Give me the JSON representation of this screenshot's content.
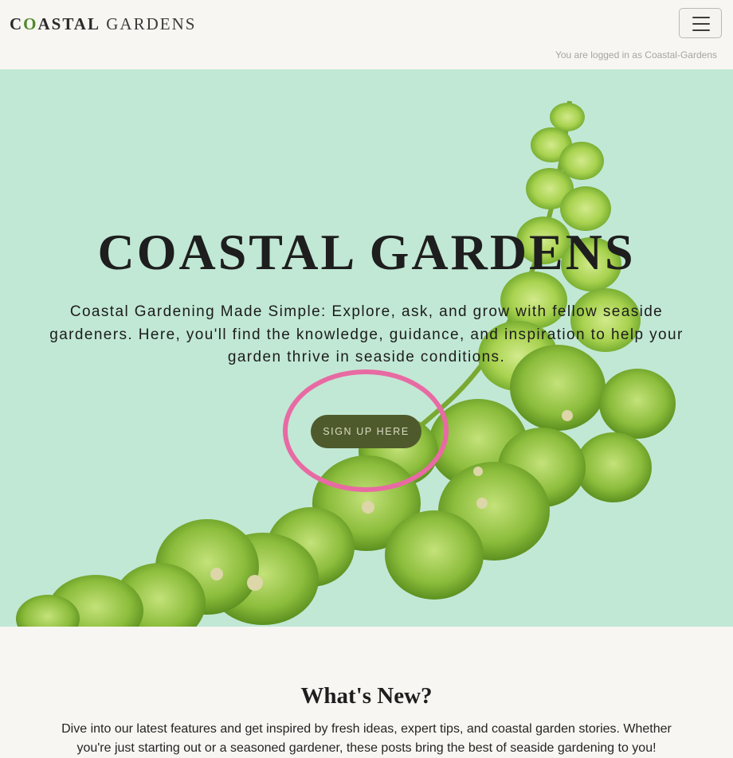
{
  "navbar": {
    "brand_c": "C",
    "brand_o": "O",
    "brand_rest": "ASTAL",
    "brand_second": "GARDENS",
    "menu_icon": "hamburger-menu-icon",
    "login_status": "You are logged in as Coastal-Gardens"
  },
  "hero": {
    "title": "COASTAL GARDENS",
    "subtitle": "Coastal Gardening Made Simple: Explore, ask, and grow with fellow seaside gardeners. Here, you'll find the knowledge, guidance, and inspiration to help your garden thrive in seaside conditions.",
    "cta_label": "SIGN UP HERE",
    "background_image": "bells-of-ireland-plant-image"
  },
  "news": {
    "heading": "What's New?",
    "text": "Dive into our latest features and get inspired by fresh ideas, expert tips, and coastal garden stories. Whether you're just starting out or a seasoned gardener, these posts bring the best of seaside gardening to you!"
  },
  "colors": {
    "hero_background": "#c1e8d5",
    "page_background": "#f8f6f2",
    "button_background": "#4f5a2c",
    "highlight_ring": "#e86aa3",
    "brand_accent": "#4f8a2b"
  }
}
